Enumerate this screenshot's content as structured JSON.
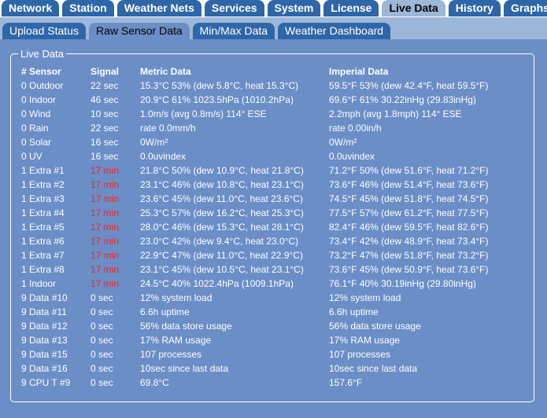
{
  "top_tabs": [
    {
      "label": "Network",
      "active": false
    },
    {
      "label": "Station",
      "active": false
    },
    {
      "label": "Weather Nets",
      "active": false
    },
    {
      "label": "Services",
      "active": false
    },
    {
      "label": "System",
      "active": false
    },
    {
      "label": "License",
      "active": false
    },
    {
      "label": "Live Data",
      "active": true
    },
    {
      "label": "History",
      "active": false
    },
    {
      "label": "Graphs",
      "active": false
    }
  ],
  "sub_tabs": [
    {
      "label": "Upload Status",
      "active": false
    },
    {
      "label": "Raw Sensor Data",
      "active": true
    },
    {
      "label": "Min/Max Data",
      "active": false
    },
    {
      "label": "Weather Dashboard",
      "active": false
    }
  ],
  "panel": {
    "legend": "Live Data"
  },
  "table": {
    "headers": {
      "sensor": "# Sensor",
      "signal": "Signal",
      "metric": "Metric Data",
      "imperial": "Imperial Data"
    },
    "stale_color": "#ff2020",
    "rows": [
      {
        "sensor": "0 Outdoor",
        "signal": "22 sec",
        "stale": false,
        "metric": "15.3°C 53% (dew 5.8°C, heat 15.3°C)",
        "imperial": "59.5°F 53% (dew 42.4°F, heat 59.5°F)"
      },
      {
        "sensor": "0 Indoor",
        "signal": "46 sec",
        "stale": false,
        "metric": "20.9°C 61% 1023.5hPa (1010.2hPa)",
        "imperial": "69.6°F 61% 30.22inHg (29.83inHg)"
      },
      {
        "sensor": "0 Wind",
        "signal": "10 sec",
        "stale": false,
        "metric": "1.0m/s (avg 0.8m/s) 114° ESE",
        "imperial": "2.2mph (avg 1.8mph) 114° ESE"
      },
      {
        "sensor": "0 Rain",
        "signal": "22 sec",
        "stale": false,
        "metric": "rate 0.0mm/h",
        "imperial": "rate 0.00in/h"
      },
      {
        "sensor": "0 Solar",
        "signal": "16 sec",
        "stale": false,
        "metric": "0W/m²",
        "imperial": "0W/m²"
      },
      {
        "sensor": "0 UV",
        "signal": "16 sec",
        "stale": false,
        "metric": "0.0uvindex",
        "imperial": "0.0uvindex"
      },
      {
        "sensor": "1 Extra #1",
        "signal": "17 min",
        "stale": true,
        "metric": "21.8°C 50% (dew 10.9°C, heat 21.8°C)",
        "imperial": "71.2°F 50% (dew 51.6°F, heat 71.2°F)"
      },
      {
        "sensor": "1 Extra #2",
        "signal": "17 min",
        "stale": true,
        "metric": "23.1°C 46% (dew 10.8°C, heat 23.1°C)",
        "imperial": "73.6°F 46% (dew 51.4°F, heat 73.6°F)"
      },
      {
        "sensor": "1 Extra #3",
        "signal": "17 min",
        "stale": true,
        "metric": "23.6°C 45% (dew 11.0°C, heat 23.6°C)",
        "imperial": "74.5°F 45% (dew 51.8°F, heat 74.5°F)"
      },
      {
        "sensor": "1 Extra #4",
        "signal": "17 min",
        "stale": true,
        "metric": "25.3°C 57% (dew 16.2°C, heat 25.3°C)",
        "imperial": "77.5°F 57% (dew 61.2°F, heat 77.5°F)"
      },
      {
        "sensor": "1 Extra #5",
        "signal": "17 min",
        "stale": true,
        "metric": "28.0°C 46% (dew 15.3°C, heat 28.1°C)",
        "imperial": "82.4°F 46% (dew 59.5°F, heat 82.6°F)"
      },
      {
        "sensor": "1 Extra #6",
        "signal": "17 min",
        "stale": true,
        "metric": "23.0°C 42% (dew 9.4°C, heat 23.0°C)",
        "imperial": "73.4°F 42% (dew 48.9°F, heat 73.4°F)"
      },
      {
        "sensor": "1 Extra #7",
        "signal": "17 min",
        "stale": true,
        "metric": "22.9°C 47% (dew 11.0°C, heat 22.9°C)",
        "imperial": "73.2°F 47% (dew 51.8°F, heat 73.2°F)"
      },
      {
        "sensor": "1 Extra #8",
        "signal": "17 min",
        "stale": true,
        "metric": "23.1°C 45% (dew 10.5°C, heat 23.1°C)",
        "imperial": "73.6°F 45% (dew 50.9°F, heat 73.6°F)"
      },
      {
        "sensor": "1 Indoor",
        "signal": "17 min",
        "stale": true,
        "metric": "24.5°C 40% 1022.4hPa (1009.1hPa)",
        "imperial": "76.1°F 40% 30.19inHg (29.80inHg)"
      },
      {
        "sensor": "9 Data #10",
        "signal": "0 sec",
        "stale": false,
        "metric": "12% system load",
        "imperial": "12% system load"
      },
      {
        "sensor": "9 Data #11",
        "signal": "0 sec",
        "stale": false,
        "metric": "6.6h uptime",
        "imperial": "6.6h uptime"
      },
      {
        "sensor": "9 Data #12",
        "signal": "0 sec",
        "stale": false,
        "metric": "56% data store usage",
        "imperial": "56% data store usage"
      },
      {
        "sensor": "9 Data #13",
        "signal": "0 sec",
        "stale": false,
        "metric": "17% RAM usage",
        "imperial": "17% RAM usage"
      },
      {
        "sensor": "9 Data #15",
        "signal": "0 sec",
        "stale": false,
        "metric": "107 processes",
        "imperial": "107 processes"
      },
      {
        "sensor": "9 Data #16",
        "signal": "0 sec",
        "stale": false,
        "metric": "10sec since last data",
        "imperial": "10sec since last data"
      },
      {
        "sensor": "9 CPU T #9",
        "signal": "0 sec",
        "stale": false,
        "metric": "69.8°C",
        "imperial": "157.6°F"
      }
    ]
  }
}
